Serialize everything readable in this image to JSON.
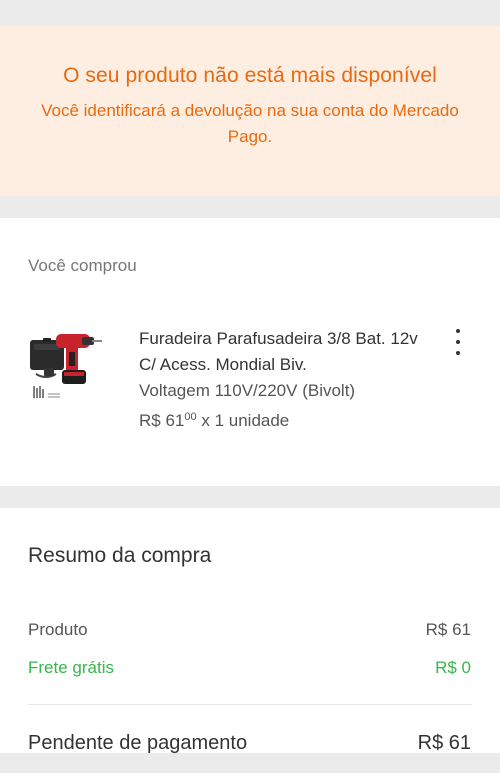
{
  "banner": {
    "title": "O seu produto não está mais disponível",
    "subtitle": "Você identificará a devolução na sua conta do Mercado Pago."
  },
  "purchase": {
    "label": "Você comprou",
    "product": {
      "name": "Furadeira Parafusadeira 3/8 Bat. 12v C/ Acess. Mondial Biv.",
      "variant": "Voltagem 110V/220V (Bivolt)",
      "price_main": "R$ 61",
      "price_cents": "00",
      "quantity": "x 1 unidade",
      "thumbnail_icon": "drill-kit-image"
    },
    "menu_icon": "more-vertical-icon"
  },
  "summary": {
    "title": "Resumo da compra",
    "rows": [
      {
        "label": "Produto",
        "value": "R$ 61"
      },
      {
        "label": "Frete grátis",
        "value": "R$ 0"
      }
    ],
    "pending": {
      "label": "Pendente de pagamento",
      "value": "R$ 61"
    }
  },
  "colors": {
    "warning": "#e86a10",
    "banner_bg": "#fdeee1",
    "free_shipping": "#39b54a"
  }
}
